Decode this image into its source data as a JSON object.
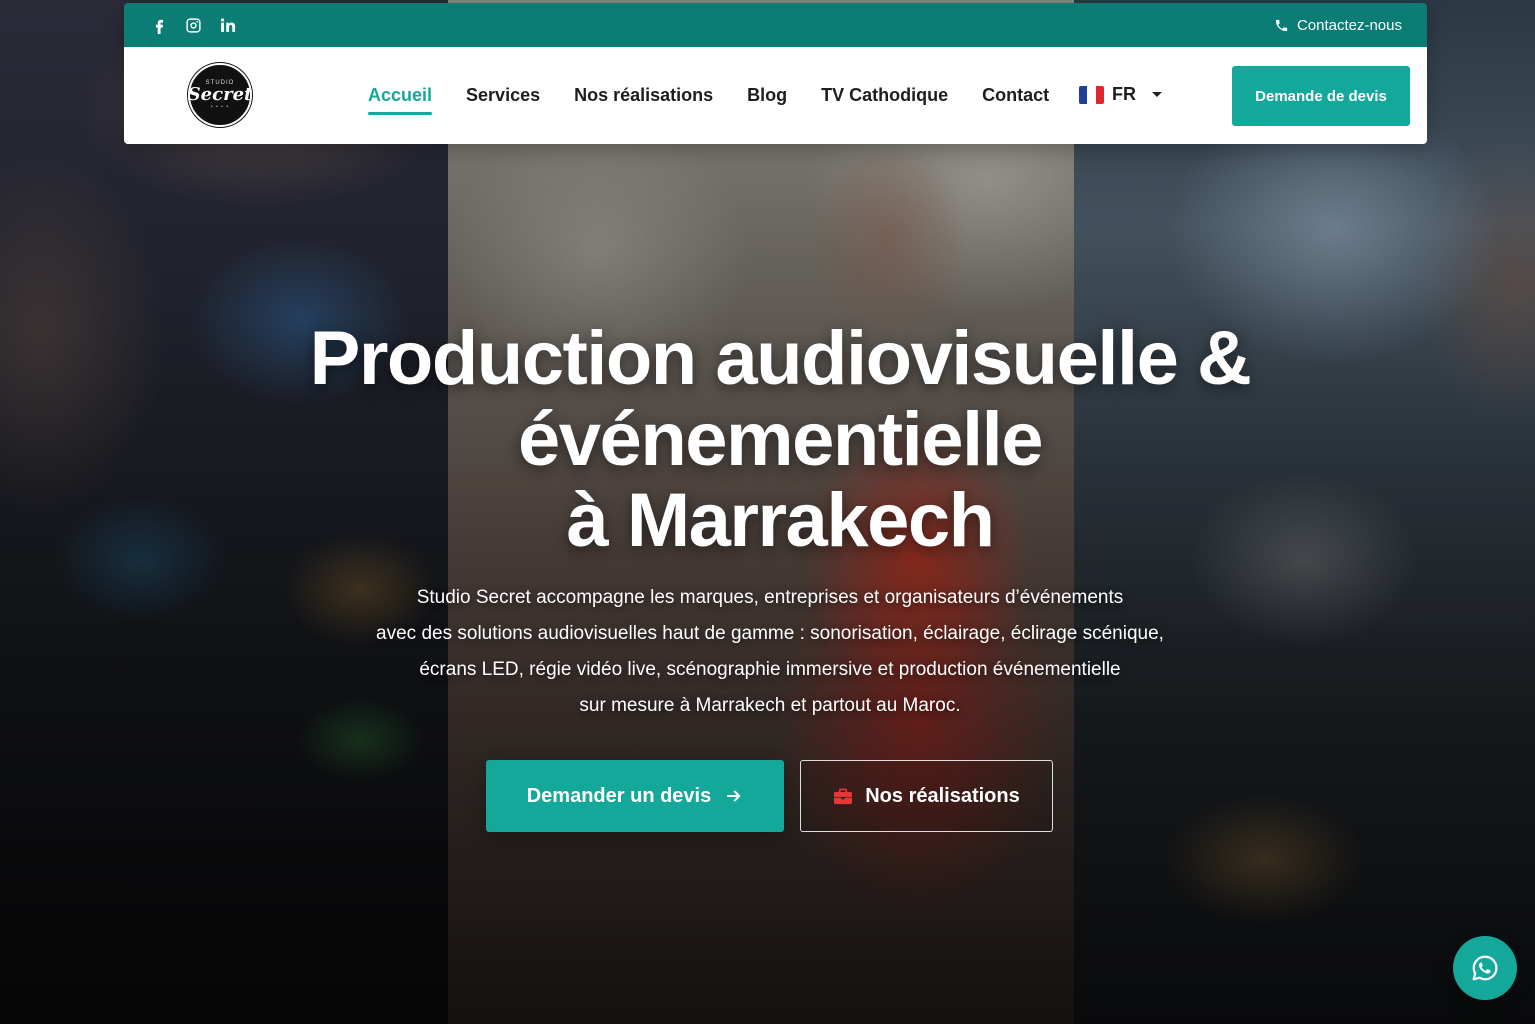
{
  "topbar": {
    "socials": [
      {
        "icon": "facebook-icon"
      },
      {
        "icon": "instagram-icon"
      },
      {
        "icon": "linkedin-icon"
      }
    ],
    "contact_label": "Contactez-nous",
    "contact_icon": "phone-icon"
  },
  "brand": {
    "logo_text": "Secret",
    "logo_small": "STUDIO"
  },
  "nav": {
    "items": [
      {
        "label": "Accueil",
        "active": true
      },
      {
        "label": "Services",
        "active": false
      },
      {
        "label": "Nos réalisations",
        "active": false
      },
      {
        "label": "Blog",
        "active": false
      },
      {
        "label": "TV Cathodique",
        "active": false
      },
      {
        "label": "Contact",
        "active": false
      }
    ],
    "language": "FR",
    "quote_button": "Demande de devis"
  },
  "hero": {
    "title_lines": [
      "Production audiovisuelle &",
      "événementielle",
      "à Marrakech"
    ],
    "text_lines": [
      "Studio Secret accompagne les marques, entreprises et organisateurs d’événements",
      "avec des solutions audiovisuelles haut de gamme : sonorisation, éclairage, éclirage scénique,",
      "écrans LED, régie vidéo live, scénographie immersive et production événementielle",
      "sur mesure à Marrakech et partout au Maroc."
    ],
    "cta_primary": "Demander un devis",
    "cta_secondary": "Nos réalisations"
  },
  "colors": {
    "accent": "#14a89a",
    "topbar": "#0b7d75",
    "nav_text": "#1e1e1e",
    "secondary_icon": "#e53935"
  },
  "floating": {
    "icon": "whatsapp-icon"
  }
}
